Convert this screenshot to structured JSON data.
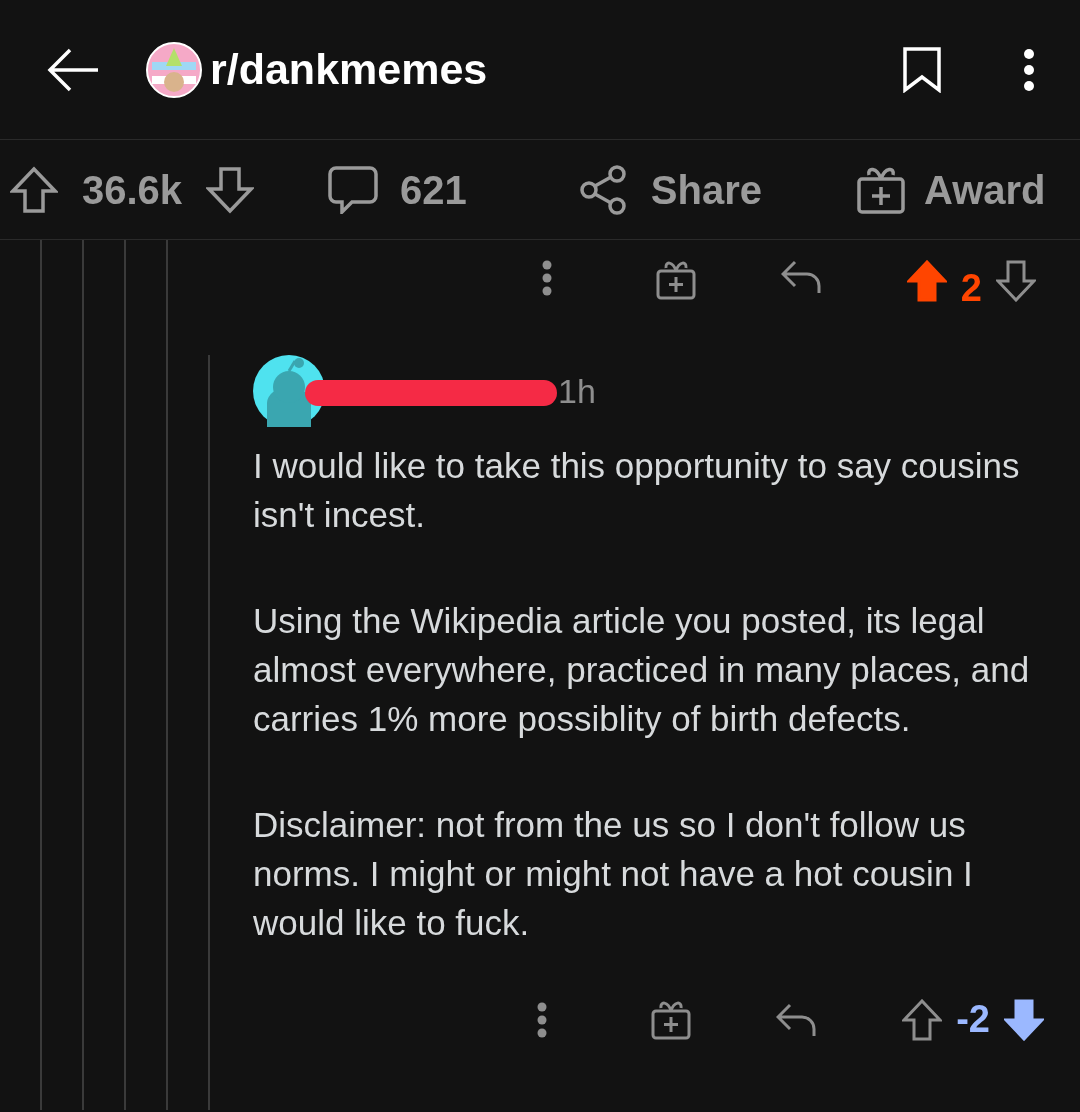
{
  "header": {
    "subreddit": "r/dankmemes"
  },
  "post_actions": {
    "score": "36.6k",
    "comments": "621",
    "share": "Share",
    "award": "Award"
  },
  "parent_comment_actions": {
    "score": "2",
    "upvoted": true,
    "downvoted": false
  },
  "comment": {
    "age": "1h",
    "username_redacted": true,
    "paragraphs": [
      "I would like to take this opportunity to say cousins isn't incest.",
      "Using the Wikipedia article you posted, its legal almost everywhere, practiced in many places, and carries 1% more possiblity of birth defects.",
      "Disclaimer: not from the us so I don't follow us norms. I might or might not have a hot cousin I would like to fuck."
    ],
    "score": "-2",
    "upvoted": false,
    "downvoted": true
  }
}
